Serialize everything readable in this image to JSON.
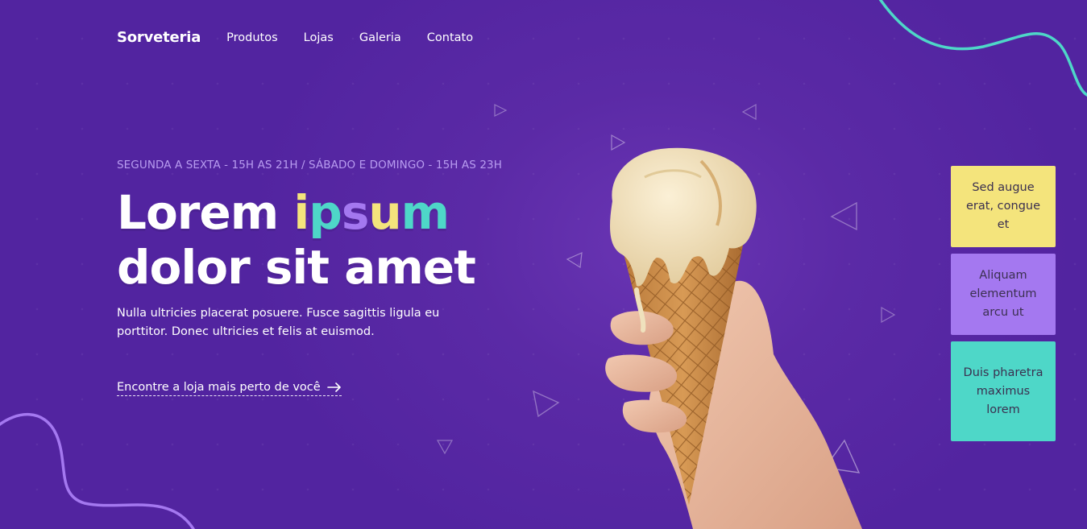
{
  "brand": {
    "logo": "Sorveteria"
  },
  "nav": {
    "items": [
      "Produtos",
      "Lojas",
      "Galeria",
      "Contato"
    ]
  },
  "hero": {
    "schedule": "SEGUNDA A SEXTA - 15H AS 21H / SÁBADO E DOMINGO - 15H AS 23H",
    "headline_part1": "Lorem",
    "headline_letters": [
      "i",
      "p",
      "s",
      "u",
      "m"
    ],
    "headline_line2": "dolor sit amet",
    "description": "Nulla ultricies placerat posuere. Fusce sagittis ligula eu porttitor. Donec ultricies et felis at euismod.",
    "cta_label": "Encontre a loja mais perto de você"
  },
  "cards": [
    {
      "text": "Sed augue erat, congue et",
      "color": "#f4e47c"
    },
    {
      "text": "Aliquam elementum arcu ut",
      "color": "#a478f0"
    },
    {
      "text": "Duis pharetra maximus lorem",
      "color": "#4ed7c8"
    }
  ],
  "colors": {
    "background": "#5224a0",
    "accent_yellow": "#f4e47c",
    "accent_teal": "#4ed7c8",
    "accent_purple": "#a478f0"
  },
  "icons": {
    "cta": "arrow-right-icon"
  },
  "image": {
    "subject": "hand holding ice cream cone"
  }
}
